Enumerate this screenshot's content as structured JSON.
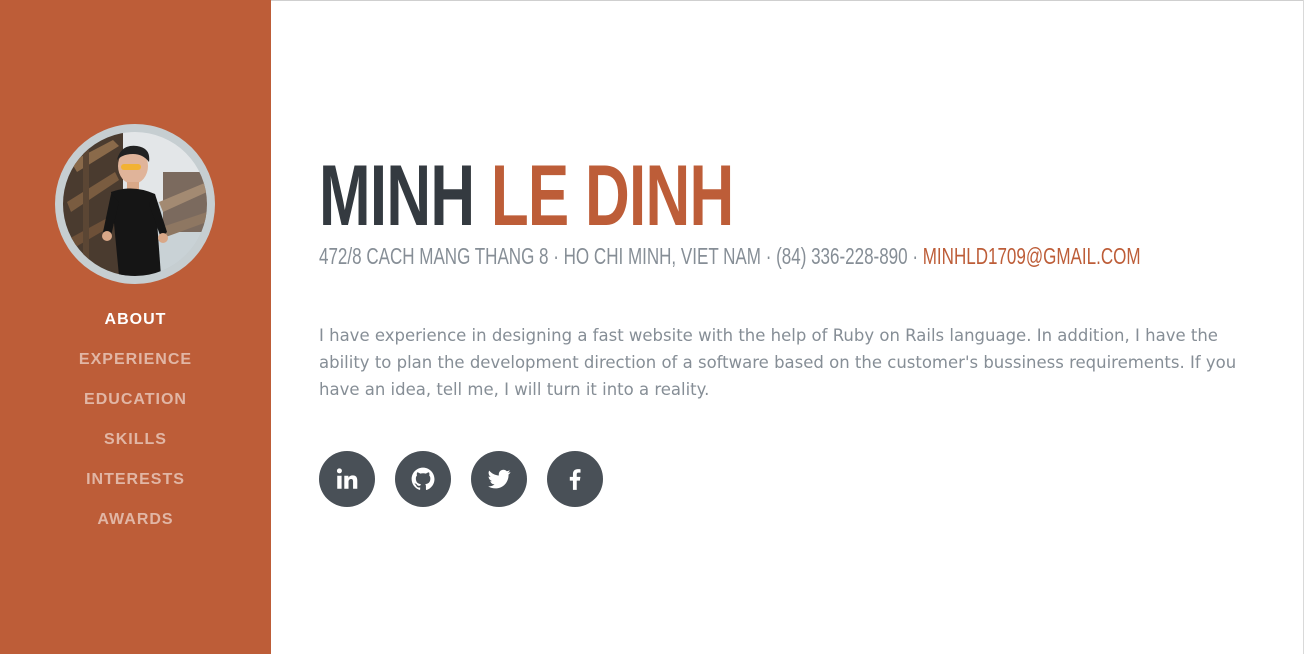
{
  "profile": {
    "first_name": "MINH",
    "last_name": "LE DINH",
    "address": "472/8 CACH MANG THANG 8 · HO CHI MINH, VIET NAM · (84) 336-228-890 ·",
    "email": "MINHLD1709@GMAIL.COM",
    "bio": "I have experience in designing a fast website with the help of Ruby on Rails language. In addition, I have the ability to plan the development direction of a software based on the customer's bussiness requirements. If you have an idea, tell me, I will turn it into a reality."
  },
  "nav": {
    "items": [
      {
        "label": "ABOUT",
        "active": true
      },
      {
        "label": "EXPERIENCE",
        "active": false
      },
      {
        "label": "EDUCATION",
        "active": false
      },
      {
        "label": "SKILLS",
        "active": false
      },
      {
        "label": "INTERESTS",
        "active": false
      },
      {
        "label": "AWARDS",
        "active": false
      }
    ]
  },
  "social": [
    "linkedin-icon",
    "github-icon",
    "twitter-icon",
    "facebook-icon"
  ],
  "colors": {
    "primary": "#bd5d38",
    "dark": "#343a40",
    "muted": "#868e96",
    "social_bg": "#495057"
  }
}
